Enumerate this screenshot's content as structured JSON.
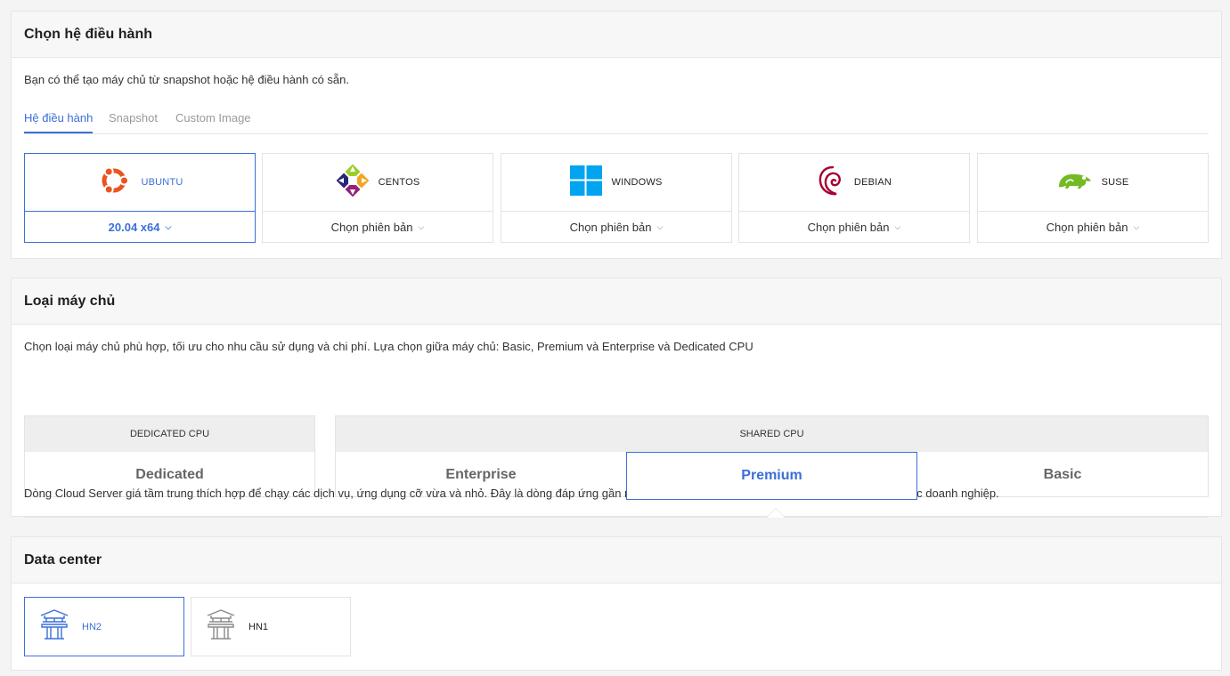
{
  "os_section": {
    "title": "Chọn hệ điều hành",
    "description": "Bạn có thể tạo máy chủ từ snapshot hoặc hệ điều hành có sẵn.",
    "tabs": [
      {
        "label": "Hệ điều hành",
        "active": true
      },
      {
        "label": "Snapshot",
        "active": false
      },
      {
        "label": "Custom Image",
        "active": false
      }
    ],
    "os_list": [
      {
        "name": "UBUNTU",
        "version": "20.04 x64",
        "selected": true,
        "icon": "ubuntu-logo-icon"
      },
      {
        "name": "CENTOS",
        "version": "Chọn phiên bản",
        "selected": false,
        "icon": "centos-logo-icon"
      },
      {
        "name": "WINDOWS",
        "version": "Chọn phiên bản",
        "selected": false,
        "icon": "windows-logo-icon"
      },
      {
        "name": "DEBIAN",
        "version": "Chọn phiên bản",
        "selected": false,
        "icon": "debian-logo-icon"
      },
      {
        "name": "SUSE",
        "version": "Chọn phiên bản",
        "selected": false,
        "icon": "suse-logo-icon"
      }
    ]
  },
  "server_type_section": {
    "title": "Loại máy chủ",
    "description": "Chọn loại máy chủ phù hợp, tối ưu cho nhu cầu sử dụng và chi phí. Lựa chọn giữa máy chủ: Basic, Premium và Enterprise và Dedicated CPU",
    "groups": [
      {
        "header": "DEDICATED CPU",
        "options": [
          "Dedicated"
        ]
      },
      {
        "header": "SHARED CPU",
        "options": [
          "Enterprise",
          "Premium",
          "Basic"
        ]
      }
    ],
    "selected": "Premium",
    "selected_description": "Dòng Cloud Server giá tầm trung thích hợp để chạy các dịch vụ, ứng dụng cỡ vừa và nhỏ. Đây là dòng đáp ứng gần như toàn bộ các nhu cầu sử dụng thông thường trong các doanh nghiệp."
  },
  "datacenter_section": {
    "title": "Data center",
    "centers": [
      {
        "label": "HN2",
        "selected": true,
        "icon": "pagoda-icon"
      },
      {
        "label": "HN1",
        "selected": false,
        "icon": "pagoda-icon"
      }
    ]
  },
  "colors": {
    "accent": "#3b6fd9",
    "ubuntu": "#e95420",
    "windows": "#00a4ef",
    "debian": "#a80030",
    "suse": "#73ba25"
  }
}
